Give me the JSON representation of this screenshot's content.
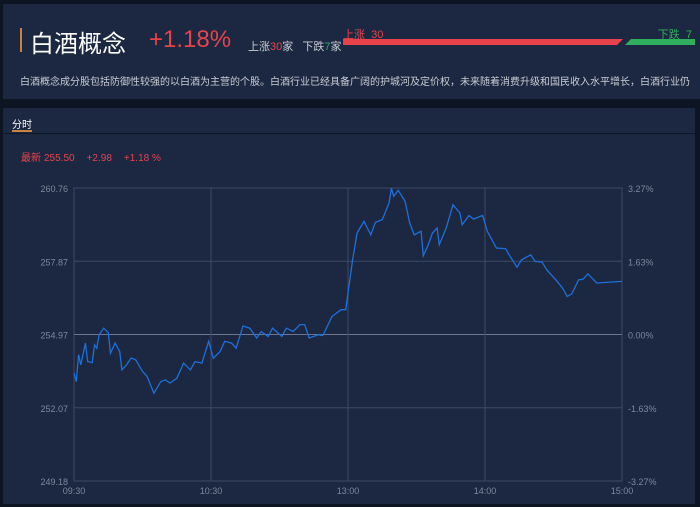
{
  "header": {
    "title": "白酒概念",
    "change_pct": "+1.18%",
    "up_label": "上涨",
    "up_count": "30",
    "down_label": "下跌",
    "down_count": "7",
    "unit": "家",
    "ratio_up_label": "上涨  30",
    "ratio_down_label": "下跌  7",
    "description": "白酒概念成分股包括防御性较强的以白酒为主营的个股。白酒行业已经具备广阔的护城河及定价权，未来随着消费升级和国民收入水平增长，白酒行业仍"
  },
  "tabs": [
    {
      "label": "分时",
      "active": true
    }
  ],
  "quote": {
    "label": "最新",
    "price": "255.50",
    "change": "+2.98",
    "change_pct": "+1.18 %"
  },
  "colors": {
    "up": "#e8434b",
    "down": "#2fae5e",
    "line": "#1e6fd9",
    "panel": "#1c2841"
  },
  "chart_data": {
    "type": "line",
    "title": "白酒概念 分时",
    "prev_close": 254.97,
    "ylim": [
      249.18,
      260.76
    ],
    "y_ticks": [
      "260.76",
      "257.87",
      "254.97",
      "252.07",
      "249.18"
    ],
    "y_ticks_right": [
      "3.27%",
      "1.63%",
      "0.00%",
      "-1.63%",
      "-3.27%"
    ],
    "x_ticks": [
      "09:30",
      "10:30",
      "13:00",
      "14:00",
      "15:00"
    ],
    "x_minutes_total": 240,
    "series": [
      {
        "name": "price",
        "points": [
          [
            0,
            253.44
          ],
          [
            1,
            253.11
          ],
          [
            2,
            254.17
          ],
          [
            3,
            253.77
          ],
          [
            5,
            254.63
          ],
          [
            6,
            253.9
          ],
          [
            8,
            253.86
          ],
          [
            9,
            254.56
          ],
          [
            10,
            254.43
          ],
          [
            11,
            254.96
          ],
          [
            13,
            255.22
          ],
          [
            15,
            255.05
          ],
          [
            16,
            254.23
          ],
          [
            18,
            254.63
          ],
          [
            20,
            254.3
          ],
          [
            21,
            253.57
          ],
          [
            23,
            253.77
          ],
          [
            25,
            254.04
          ],
          [
            27,
            253.97
          ],
          [
            30,
            253.51
          ],
          [
            32,
            253.31
          ],
          [
            35,
            252.65
          ],
          [
            38,
            253.11
          ],
          [
            40,
            253.18
          ],
          [
            42,
            253.05
          ],
          [
            45,
            253.24
          ],
          [
            48,
            253.84
          ],
          [
            51,
            253.57
          ],
          [
            53,
            253.9
          ],
          [
            56,
            253.84
          ],
          [
            59,
            254.7
          ],
          [
            61,
            254.03
          ],
          [
            64,
            254.3
          ],
          [
            66,
            254.7
          ],
          [
            69,
            254.63
          ],
          [
            71,
            254.43
          ],
          [
            74,
            255.31
          ],
          [
            77,
            255.22
          ],
          [
            80,
            254.83
          ],
          [
            82,
            255.09
          ],
          [
            85,
            254.89
          ],
          [
            87,
            255.22
          ],
          [
            91,
            254.89
          ],
          [
            93,
            255.22
          ],
          [
            96,
            255.09
          ],
          [
            99,
            255.36
          ],
          [
            101,
            255.36
          ],
          [
            103,
            254.83
          ],
          [
            107,
            254.96
          ],
          [
            109,
            254.93
          ],
          [
            113,
            255.68
          ],
          [
            117,
            255.95
          ],
          [
            119,
            255.95
          ],
          [
            122,
            257.92
          ],
          [
            124,
            258.98
          ],
          [
            127,
            259.44
          ],
          [
            130,
            258.91
          ],
          [
            132,
            259.4
          ],
          [
            135,
            259.51
          ],
          [
            138,
            260.17
          ],
          [
            139,
            260.76
          ],
          [
            140,
            260.43
          ],
          [
            142,
            260.67
          ],
          [
            145,
            260.23
          ],
          [
            147,
            259.38
          ],
          [
            149,
            258.91
          ],
          [
            152,
            259.05
          ],
          [
            153,
            258.08
          ],
          [
            155,
            258.48
          ],
          [
            157,
            258.98
          ],
          [
            159,
            259.18
          ],
          [
            160,
            258.52
          ],
          [
            163,
            259.18
          ],
          [
            166,
            260.1
          ],
          [
            169,
            259.77
          ],
          [
            170,
            259.31
          ],
          [
            173,
            259.67
          ],
          [
            175,
            259.53
          ],
          [
            178,
            259.64
          ],
          [
            179,
            259.67
          ],
          [
            181,
            259.05
          ],
          [
            185,
            258.39
          ],
          [
            189,
            258.36
          ],
          [
            191,
            258.06
          ],
          [
            194,
            257.63
          ],
          [
            196,
            257.92
          ],
          [
            200,
            258.12
          ],
          [
            202,
            257.86
          ],
          [
            205,
            257.83
          ],
          [
            207,
            257.53
          ],
          [
            211,
            257.13
          ],
          [
            214,
            256.8
          ],
          [
            216,
            256.47
          ],
          [
            218,
            256.58
          ],
          [
            221,
            257.13
          ],
          [
            223,
            257.16
          ],
          [
            225,
            257.37
          ],
          [
            229,
            257.0
          ],
          [
            233,
            257.03
          ],
          [
            240,
            257.07
          ]
        ]
      }
    ]
  }
}
